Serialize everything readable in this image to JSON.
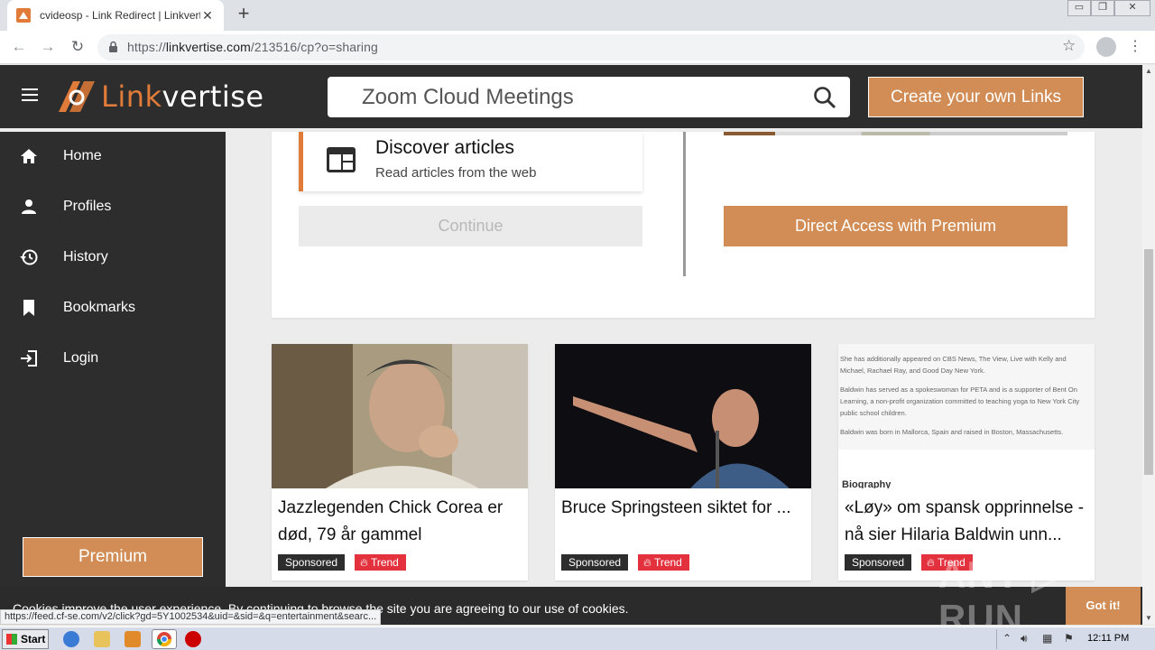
{
  "browser": {
    "tab_title": "cvideosp - Link Redirect | Linkvertise",
    "tab_close": "✕",
    "new_tab": "+",
    "url_prefix": "https://",
    "url_host": "linkvertise.com",
    "url_path": "/213516/cp?o=sharing",
    "status_url": "https://feed.cf-se.com/v2/click?gd=5Y1002534&uid=&sid=&q=entertainment&searc...",
    "window_controls": [
      "▭",
      "❐",
      "✕"
    ]
  },
  "header": {
    "logo_text_accent": "Link",
    "logo_text_rest": "vertise",
    "search_value": "Zoom Cloud Meetings",
    "cta_label": "Create your own Links"
  },
  "sidebar": {
    "items": [
      {
        "label": "Home",
        "icon": "home-icon"
      },
      {
        "label": "Profiles",
        "icon": "person-icon"
      },
      {
        "label": "History",
        "icon": "history-icon"
      },
      {
        "label": "Bookmarks",
        "icon": "bookmark-icon"
      },
      {
        "label": "Login",
        "icon": "login-icon"
      }
    ],
    "premium_label": "Premium"
  },
  "main": {
    "article_title": "Discover articles",
    "article_subtitle": "Read articles from the web",
    "continue_label": "Continue",
    "direct_access_label": "Direct Access with Premium"
  },
  "news": [
    {
      "title": "Jazzlegenden Chick Corea er død, 79 år gammel",
      "sponsored": "Sponsored",
      "trend": "Trend"
    },
    {
      "title": "Bruce Springsteen siktet for ...",
      "sponsored": "Sponsored",
      "trend": "Trend"
    },
    {
      "title": "«Løy» om spansk opprinnelse - nå sier Hilaria Baldwin unn...",
      "sponsored": "Sponsored",
      "trend": "Trend",
      "image_text": {
        "line1": "She has additionally appeared on CBS News, The View, Live with Kelly and Michael, Rachael Ray, and Good Day New York.",
        "line2": "Baldwin has served as a spokeswoman for PETA and is a supporter of Bent On Learning, a non-profit organization committed to teaching yoga to New York City public school children.",
        "line3": "Baldwin was born in Mallorca, Spain and raised in Boston, Massachusetts.",
        "heading": "Biography"
      }
    }
  ],
  "cookie": {
    "text": "Cookies improve the user experience. By continuing to browse the site you are agreeing to our use of cookies.",
    "button": "Got it!"
  },
  "watermark": "ANY ▷ RUN",
  "taskbar": {
    "start_label": "Start",
    "clock": "12:11 PM"
  },
  "colors": {
    "accent": "#d18d55",
    "logo_orange": "#e07b39",
    "dark": "#2d2d2d",
    "trend_red": "#e3313d"
  }
}
